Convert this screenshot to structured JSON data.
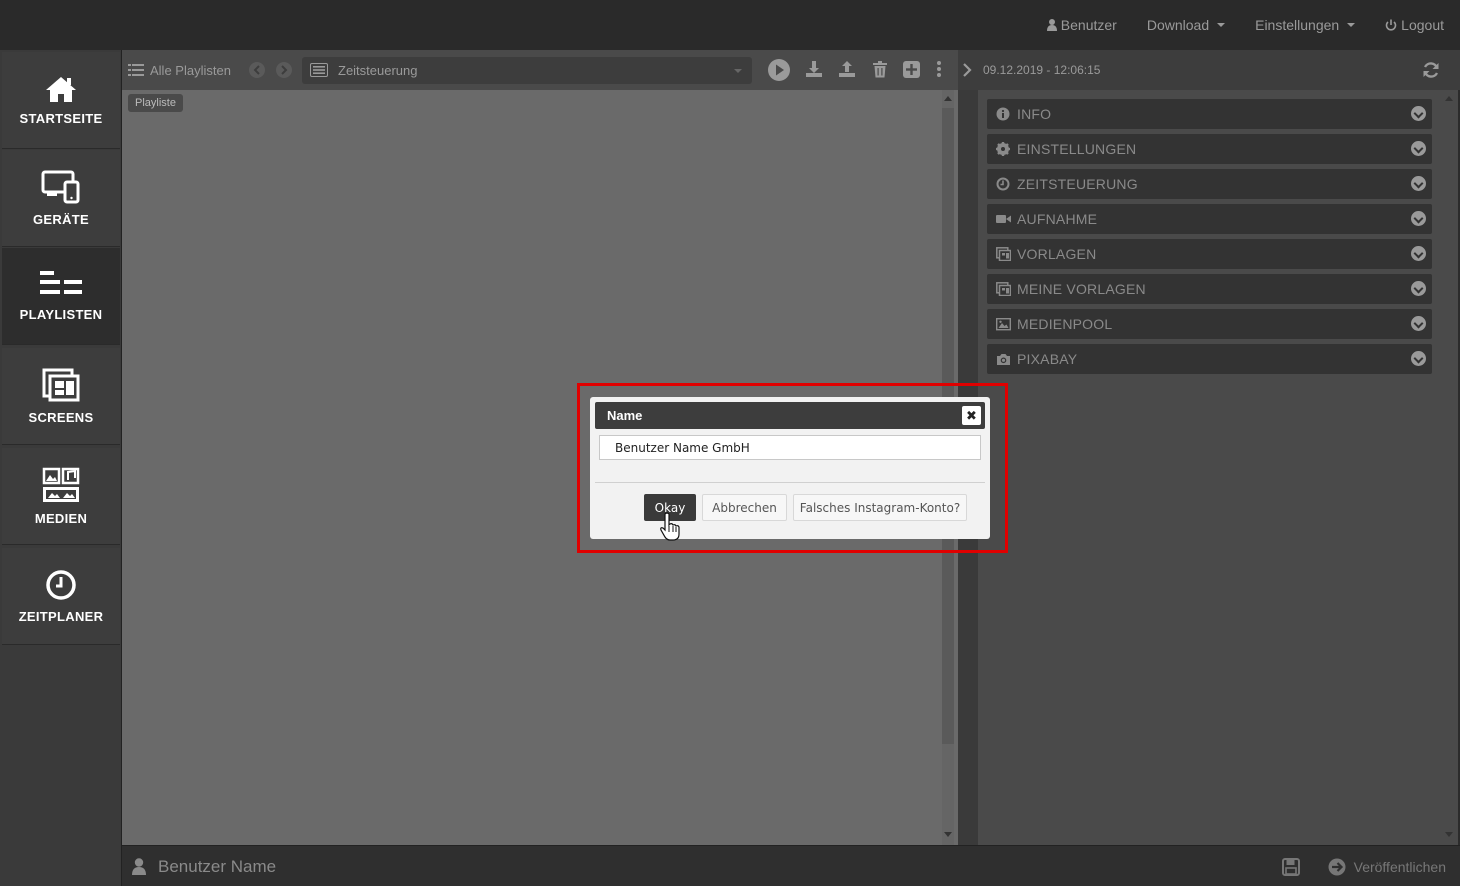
{
  "topnav": {
    "user_label": "Benutzer",
    "download_label": "Download",
    "settings_label": "Einstellungen",
    "logout_label": "Logout"
  },
  "sidebar": {
    "items": [
      {
        "label": "STARTSEITE",
        "icon": "home-icon"
      },
      {
        "label": "GERÄTE",
        "icon": "devices-icon"
      },
      {
        "label": "PLAYLISTEN",
        "icon": "playlist-icon",
        "active": true
      },
      {
        "label": "SCREENS",
        "icon": "screens-icon"
      },
      {
        "label": "MEDIEN",
        "icon": "media-icon"
      },
      {
        "label": "ZEITPLANER",
        "icon": "clock-icon"
      }
    ]
  },
  "center": {
    "all_playlists_label": "Alle Playlisten",
    "select_value": "Zeitsteuerung",
    "tag_label": "Playliste"
  },
  "right": {
    "timestamp": "09.12.2019 - 12:06:15",
    "accordions": [
      {
        "label": "INFO",
        "icon": "info-icon"
      },
      {
        "label": "EINSTELLUNGEN",
        "icon": "gear-icon"
      },
      {
        "label": "ZEITSTEUERUNG",
        "icon": "clock-icon"
      },
      {
        "label": "AUFNAHME",
        "icon": "video-camera-icon"
      },
      {
        "label": "VORLAGEN",
        "icon": "template-icon"
      },
      {
        "label": "MEINE VORLAGEN",
        "icon": "template-icon"
      },
      {
        "label": "MEDIENPOOL",
        "icon": "image-icon"
      },
      {
        "label": "PIXABAY",
        "icon": "camera-icon"
      }
    ]
  },
  "footer": {
    "user_name": "Benutzer Name",
    "publish_label": "Veröffentlichen"
  },
  "modal": {
    "title": "Name",
    "close_symbol": "✖",
    "input_value": "Benutzer Name GmbH",
    "ok_label": "Okay",
    "cancel_label": "Abbrechen",
    "wrong_account_label": "Falsches Instagram-Konto?"
  },
  "colors": {
    "highlight": "#e00000",
    "modal_button_dark": "#3a3a3a"
  }
}
